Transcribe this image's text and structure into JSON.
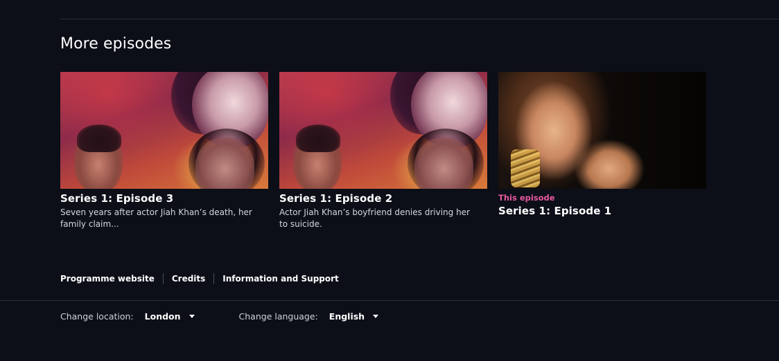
{
  "section": {
    "title": "More episodes"
  },
  "episodes": [
    {
      "title": "Series 1: Episode 3",
      "description": "Seven years after actor Jiah Khan’s death, her family claim..."
    },
    {
      "title": "Series 1: Episode 2",
      "description": "Actor Jiah Khan’s boyfriend denies driving her to suicide."
    },
    {
      "label": "This episode",
      "title": "Series 1: Episode 1"
    }
  ],
  "footer": {
    "links": [
      "Programme website",
      "Credits",
      "Information and Support"
    ]
  },
  "settings": {
    "location": {
      "label": "Change location:",
      "value": "London"
    },
    "language": {
      "label": "Change language:",
      "value": "English"
    }
  },
  "colors": {
    "background": "#0c0e18",
    "current_episode_accent": "#e85aa0"
  }
}
